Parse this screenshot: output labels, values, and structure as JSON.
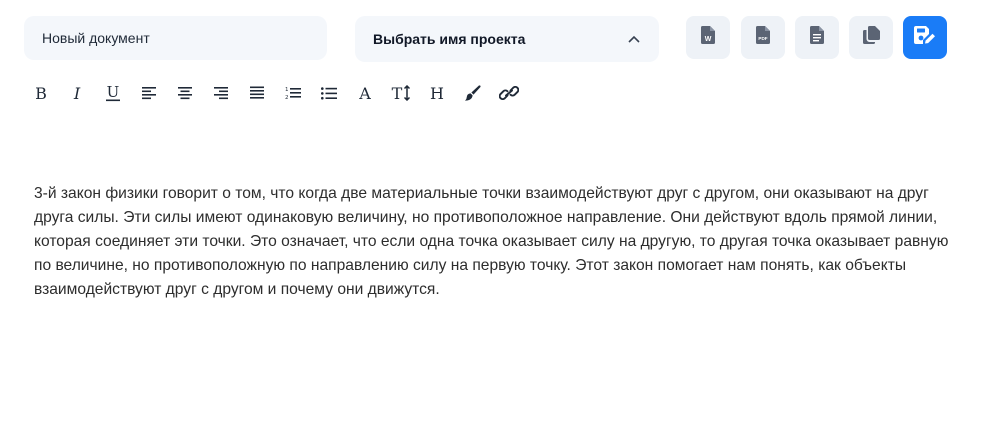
{
  "document": {
    "name_placeholder": "Новый документ",
    "project_select_label": "Выбрать имя проекта",
    "body_text": "3-й закон физики говорит о том, что когда две материальные точки взаимодействуют друг с другом, они оказывают на друг друга силы. Эти силы имеют одинаковую величину, но противоположное направление. Они действуют вдоль прямой линии, которая соединяет эти точки. Это означает, что если одна точка оказывает силу на другую, то другая точка оказывает равную по величине, но противоположную по направлению силу на первую точку. Этот закон помогает нам понять, как объекты взаимодействуют друг с другом и почему они движутся."
  },
  "actions": [
    {
      "icon": "word-file-icon",
      "glyph": "W"
    },
    {
      "icon": "pdf-file-icon",
      "glyph": "PDF"
    },
    {
      "icon": "document-file-icon"
    },
    {
      "icon": "copy-icon"
    },
    {
      "icon": "save-edit-icon"
    }
  ],
  "toolbar": [
    {
      "icon": "bold-icon",
      "glyph": "B"
    },
    {
      "icon": "italic-icon",
      "glyph": "I"
    },
    {
      "icon": "underline-icon",
      "glyph": "U"
    },
    {
      "icon": "align-left-icon"
    },
    {
      "icon": "align-center-icon"
    },
    {
      "icon": "align-right-icon"
    },
    {
      "icon": "align-justify-icon"
    },
    {
      "icon": "ordered-list-icon"
    },
    {
      "icon": "bullet-list-icon"
    },
    {
      "icon": "font-color-icon",
      "glyph": "A"
    },
    {
      "icon": "font-size-icon",
      "glyph": "T"
    },
    {
      "icon": "heading-icon",
      "glyph": "H"
    },
    {
      "icon": "brush-icon"
    },
    {
      "icon": "link-icon"
    }
  ],
  "colors": {
    "primary": "#1a7cf7",
    "button_bg": "#eef2f7",
    "field_bg": "#f4f7fb",
    "icon_gray": "#5b6474"
  }
}
